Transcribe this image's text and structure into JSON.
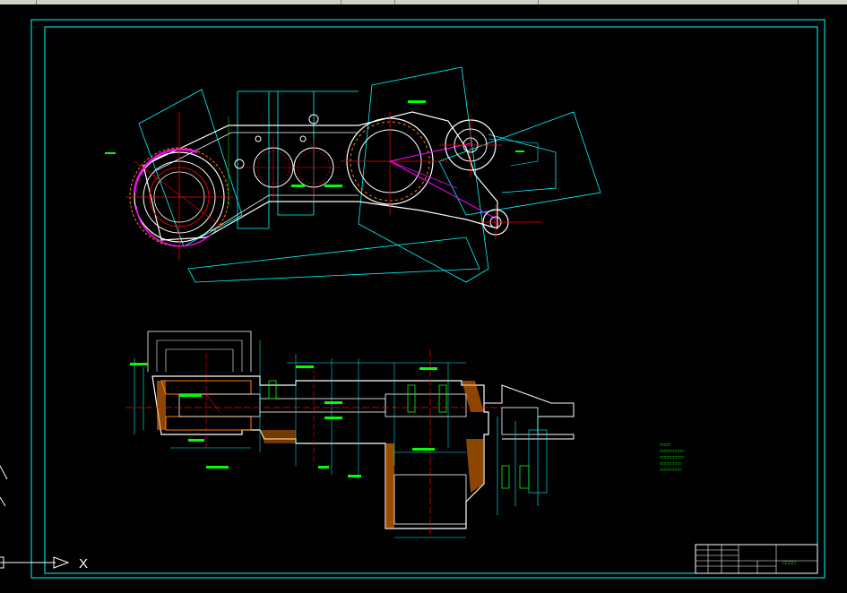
{
  "app": {
    "kind": "CAD model space",
    "background": "#000000"
  },
  "colors": {
    "frame": "#00ffff",
    "geometry": "#ffffff",
    "centerline": "#ff0000",
    "dimension": "#00ffff",
    "highlight": "#ff00ff",
    "note": "#00ff00",
    "hatch": "#ff8000"
  },
  "ucs": {
    "x_label": "X",
    "icon": "ucs-axis-icon"
  },
  "title_block": {
    "label": "□□□□"
  },
  "notes": {
    "technical_requirements": [
      "□□□□",
      "□□□□□□□□□",
      "□□□□□□□□□",
      "□□□□□□□□",
      "□□□□□□□□"
    ]
  }
}
